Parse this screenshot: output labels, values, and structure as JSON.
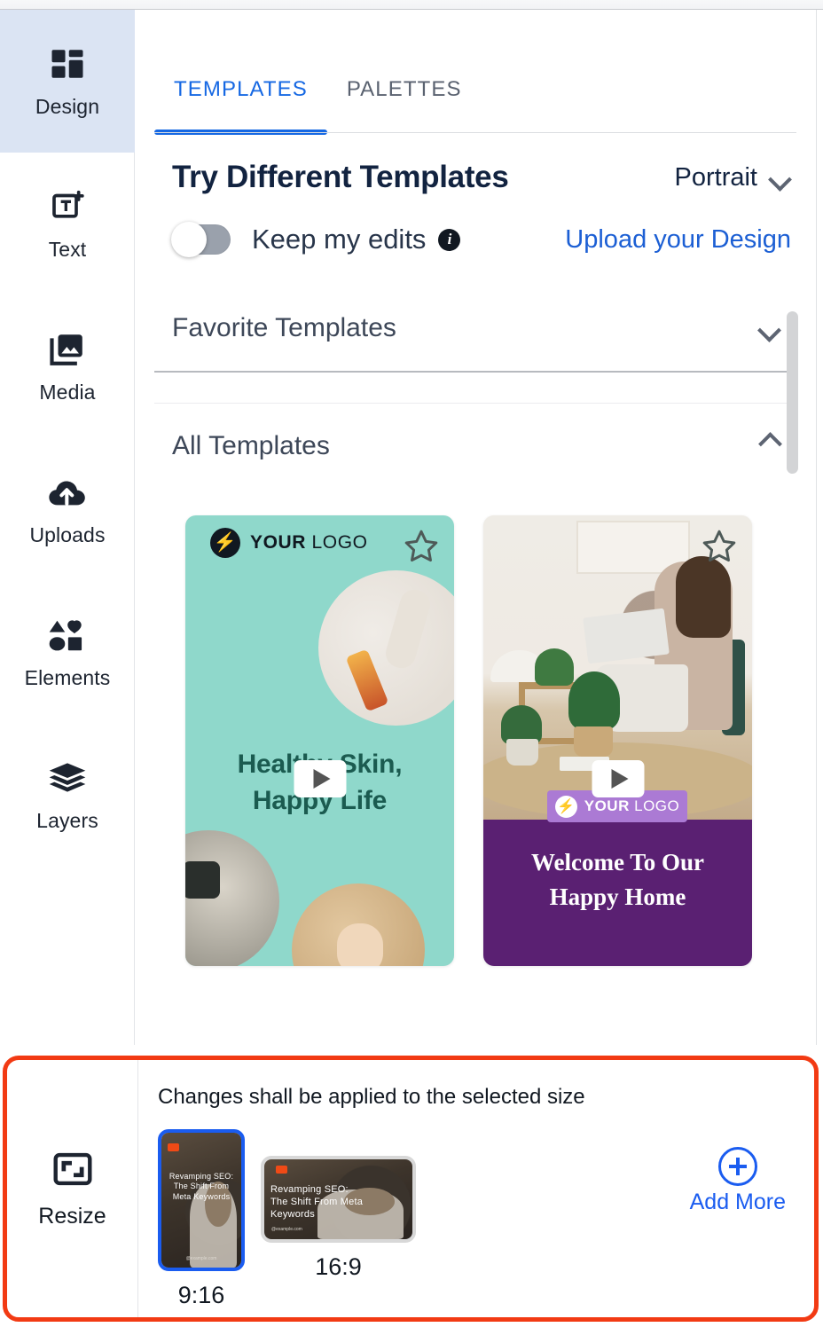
{
  "sidebar": {
    "items": [
      {
        "label": "Design",
        "icon": "grid-icon",
        "active": true
      },
      {
        "label": "Text",
        "icon": "text-add-icon",
        "active": false
      },
      {
        "label": "Media",
        "icon": "image-icon",
        "active": false
      },
      {
        "label": "Uploads",
        "icon": "cloud-upload-icon",
        "active": false
      },
      {
        "label": "Elements",
        "icon": "shapes-icon",
        "active": false
      },
      {
        "label": "Layers",
        "icon": "layers-icon",
        "active": false
      }
    ]
  },
  "tabs": [
    {
      "label": "TEMPLATES",
      "active": true
    },
    {
      "label": "PALETTES",
      "active": false
    }
  ],
  "panel": {
    "title": "Try Different Templates",
    "ratio_selected": "Portrait",
    "ratio_chevron_icon": "chevron-down-icon",
    "keep_edits_label": "Keep my edits",
    "keep_edits_on": false,
    "info_icon": "info-icon",
    "upload_link": "Upload your Design",
    "sections": [
      {
        "title": "Favorite Templates",
        "expanded": false,
        "chevron_icon": "chevron-down-icon"
      },
      {
        "title": "All Templates",
        "expanded": true,
        "chevron_icon": "chevron-up-icon"
      }
    ]
  },
  "templates": [
    {
      "id": "healthy-skin",
      "logo_bold": "YOUR",
      "logo_light": "LOGO",
      "headline_line1": "Healthy Skin,",
      "headline_line2": "Happy Life",
      "star_icon": "star-outline-icon",
      "play_icon": "play-icon",
      "bg_color": "#8fd8cb",
      "text_color": "#1b5b50"
    },
    {
      "id": "happy-home",
      "logo_bold": "YOUR",
      "logo_light": "LOGO",
      "headline_line1": "Welcome To Our",
      "headline_line2": "Happy Home",
      "star_icon": "star-outline-icon",
      "play_icon": "play-icon",
      "bg_color": "#5a2072",
      "text_color": "#ffffff"
    }
  ],
  "resize": {
    "tool_label": "Resize",
    "tool_icon": "resize-icon",
    "note": "Changes shall be applied to the selected size",
    "highlight_color": "#f23a13",
    "sizes": [
      {
        "ratio": "9:16",
        "selected": true,
        "title": "Revamping SEO: The Shift From Meta Keywords",
        "url": "@example.com"
      },
      {
        "ratio": "16:9",
        "selected": false,
        "title": "Revamping SEO: The Shift From Meta Keywords",
        "url": "@example.com"
      }
    ],
    "add_more_label": "Add More",
    "add_more_icon": "plus-circle-icon",
    "accent_color": "#1a5cf0"
  }
}
